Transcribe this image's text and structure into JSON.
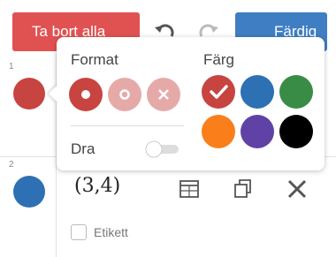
{
  "toolbar": {
    "remove_all_label": "Ta bort alla",
    "done_label": "Färdig",
    "colors": {
      "remove": "#e05252",
      "done": "#3f7ec2"
    }
  },
  "popover": {
    "format_title": "Format",
    "color_title": "Färg",
    "drag_label": "Dra",
    "drag_enabled": false,
    "point_styles": [
      "filled-dot",
      "open-dot",
      "cross"
    ],
    "selected_style": "filled-dot",
    "colors": [
      "#c74440",
      "#2d70b3",
      "#388c46",
      "#fa7e19",
      "#6042a6",
      "#000000"
    ],
    "selected_color": "#c74440"
  },
  "rows": [
    {
      "number": "1",
      "color": "#c74440"
    },
    {
      "number": "2",
      "color": "#2d70b3",
      "expression": "(3,4)",
      "label_option": "Etikett"
    }
  ]
}
